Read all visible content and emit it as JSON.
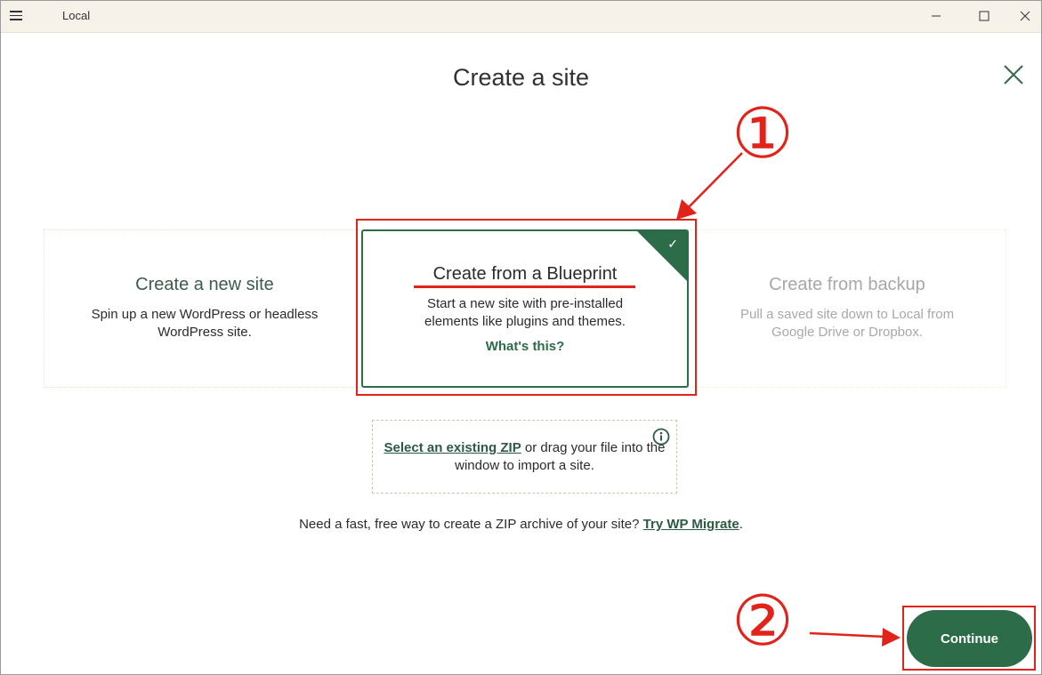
{
  "window": {
    "title": "Local"
  },
  "page": {
    "title": "Create a site"
  },
  "cards": [
    {
      "title": "Create a new site",
      "description": "Spin up a new WordPress or headless WordPress site."
    },
    {
      "title": "Create from a Blueprint",
      "description": "Start a new site with pre-installed elements like plugins and themes.",
      "link": "What's this?",
      "selected": true
    },
    {
      "title": "Create from backup",
      "description": "Pull a saved site down to Local from Google Drive or Dropbox.",
      "disabled": true
    }
  ],
  "zip": {
    "link": "Select an existing ZIP",
    "text": " or drag your file into the window to import a site."
  },
  "migrate": {
    "text": "Need a fast, free way to create a ZIP archive of your site? ",
    "link": "Try WP Migrate",
    "suffix": "."
  },
  "continue_label": "Continue",
  "annotations": {
    "step1": "①",
    "step2": "②"
  },
  "icons": {
    "menu": "hamburger-menu-icon",
    "close": "close-icon",
    "info": "info-icon",
    "check": "check-icon"
  },
  "colors": {
    "brand_green": "#2c6c49",
    "annotation_red": "#e2231a",
    "titlebar": "#f6f1e9"
  }
}
